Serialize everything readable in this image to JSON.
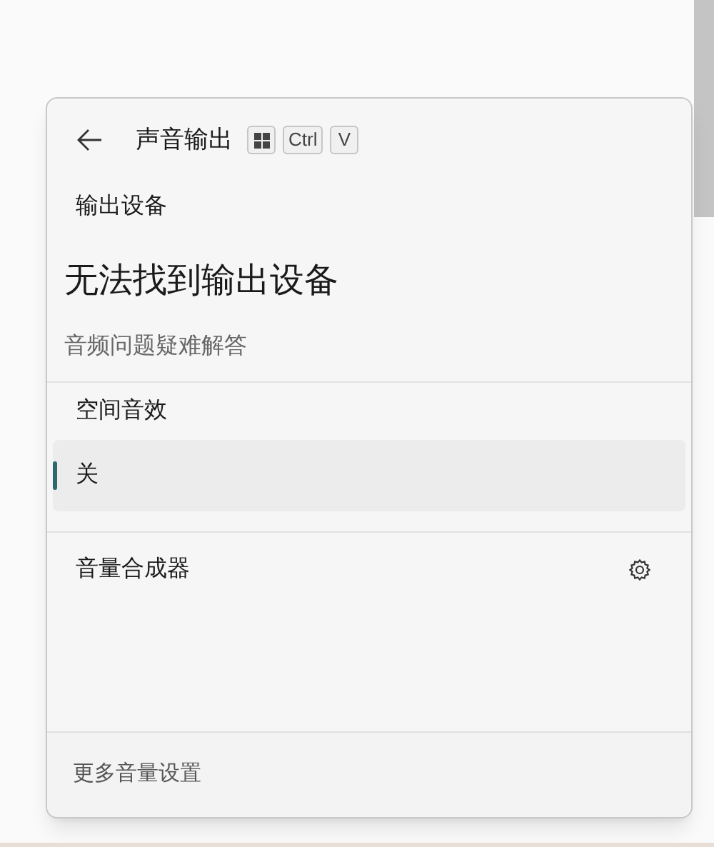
{
  "header": {
    "title": "声音输出",
    "shortcut": [
      {
        "kind": "windows"
      },
      {
        "kind": "key",
        "label": "Ctrl"
      },
      {
        "kind": "key",
        "label": "V"
      }
    ]
  },
  "output": {
    "label": "输出设备",
    "status": "无法找到输出设备",
    "troubleshoot": "音频问题疑难解答"
  },
  "spatial_sound": {
    "label": "空间音效",
    "options": [
      {
        "label": "关",
        "selected": true
      }
    ]
  },
  "mixer": {
    "label": "音量合成器"
  },
  "footer": {
    "link": "更多音量设置"
  }
}
